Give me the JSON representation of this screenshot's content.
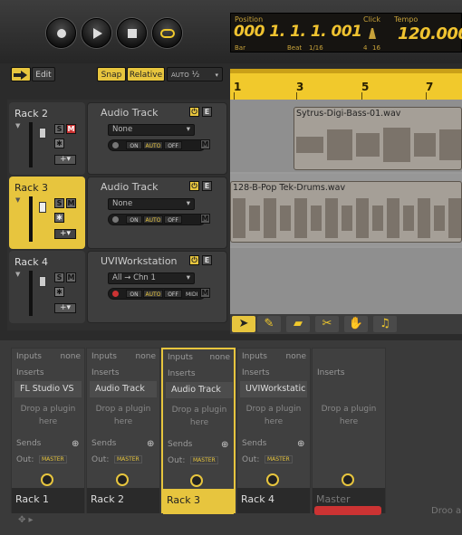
{
  "transport": {
    "position_label": "Position",
    "position_value": "000 1.  1.  1. 001",
    "bar_label": "Bar",
    "beat_label": "Beat",
    "beat_division": "1/16",
    "click_label": "Click",
    "time_sig_num": "4",
    "time_sig_den": "16",
    "tempo_label": "Tempo",
    "tempo_value": "120.000"
  },
  "toolbar": {
    "edit_label": "Edit",
    "snap_label": "Snap",
    "relative_label": "Relative",
    "auto_label": "AUTO",
    "auto_value": "½"
  },
  "ruler": {
    "marks": [
      "1",
      "3",
      "5",
      "7"
    ]
  },
  "racks": [
    {
      "name": "Rack 2",
      "track_title": "Audio Track",
      "input": "None",
      "selected": false
    },
    {
      "name": "Rack 3",
      "track_title": "Audio Track",
      "input": "None",
      "selected": true
    },
    {
      "name": "Rack 4",
      "track_title": "UVIWorkstation",
      "input": "All → Chn 1",
      "selected": false
    }
  ],
  "track_controls": {
    "on": "ON",
    "auto": "AUTO",
    "off": "OFF",
    "midi": "MIDI",
    "s": "S",
    "m": "M",
    "m_btn": "M",
    "i": "I",
    "e": "E"
  },
  "clips": [
    {
      "name": "Sytrus-Digi-Bass-01.wav"
    },
    {
      "name": "128-B-Pop Tek-Drums.wav"
    }
  ],
  "mixer": {
    "inputs_label": "Inputs",
    "none_label": "none",
    "inserts_label": "Inserts",
    "sends_label": "Sends",
    "out_label": "Out:",
    "master_tag": "MASTER",
    "drop_text": "Drop a plugin here",
    "drop_partial": "Droo a",
    "strips": [
      {
        "name": "Rack 1",
        "insert": "FL Studio VS"
      },
      {
        "name": "Rack 2",
        "insert": "Audio Track"
      },
      {
        "name": "Rack 3",
        "insert": "Audio Track"
      },
      {
        "name": "Rack 4",
        "insert": "UVIWorkstatic"
      },
      {
        "name": "Master",
        "insert": ""
      }
    ]
  },
  "colors": {
    "accent": "#e7c53e",
    "lcd_text": "#f0c330",
    "record_red": "#c33"
  }
}
